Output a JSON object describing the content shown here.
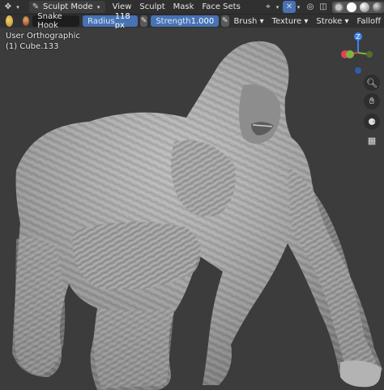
{
  "header": {
    "mode": "Sculpt Mode",
    "menus": [
      "View",
      "Sculpt",
      "Mask",
      "Face Sets"
    ],
    "icons": [
      "object-interaction-icon",
      "sculpt-brush-icon",
      "symmetry-icon",
      "overlay-icon",
      "xray-icon",
      "shading-modes-icon"
    ]
  },
  "toolbar": {
    "brush_name": "Snake Hook",
    "radius_label": "Radius",
    "radius_value": "118 px",
    "strength_label": "Strength",
    "strength_value": "1.000",
    "menus": [
      "Brush",
      "Texture",
      "Stroke",
      "Falloff"
    ]
  },
  "viewport": {
    "view_name": "User Orthographic",
    "object_name": "(1) Cube.133",
    "gizmo": {
      "z_label": "Z",
      "colors": {
        "x": "#e3425a",
        "y": "#7fb53e",
        "z": "#3d84e6"
      }
    },
    "nav_icons": [
      "zoom-icon",
      "pan-hand-icon",
      "camera-icon",
      "grid-toggle-icon"
    ]
  }
}
